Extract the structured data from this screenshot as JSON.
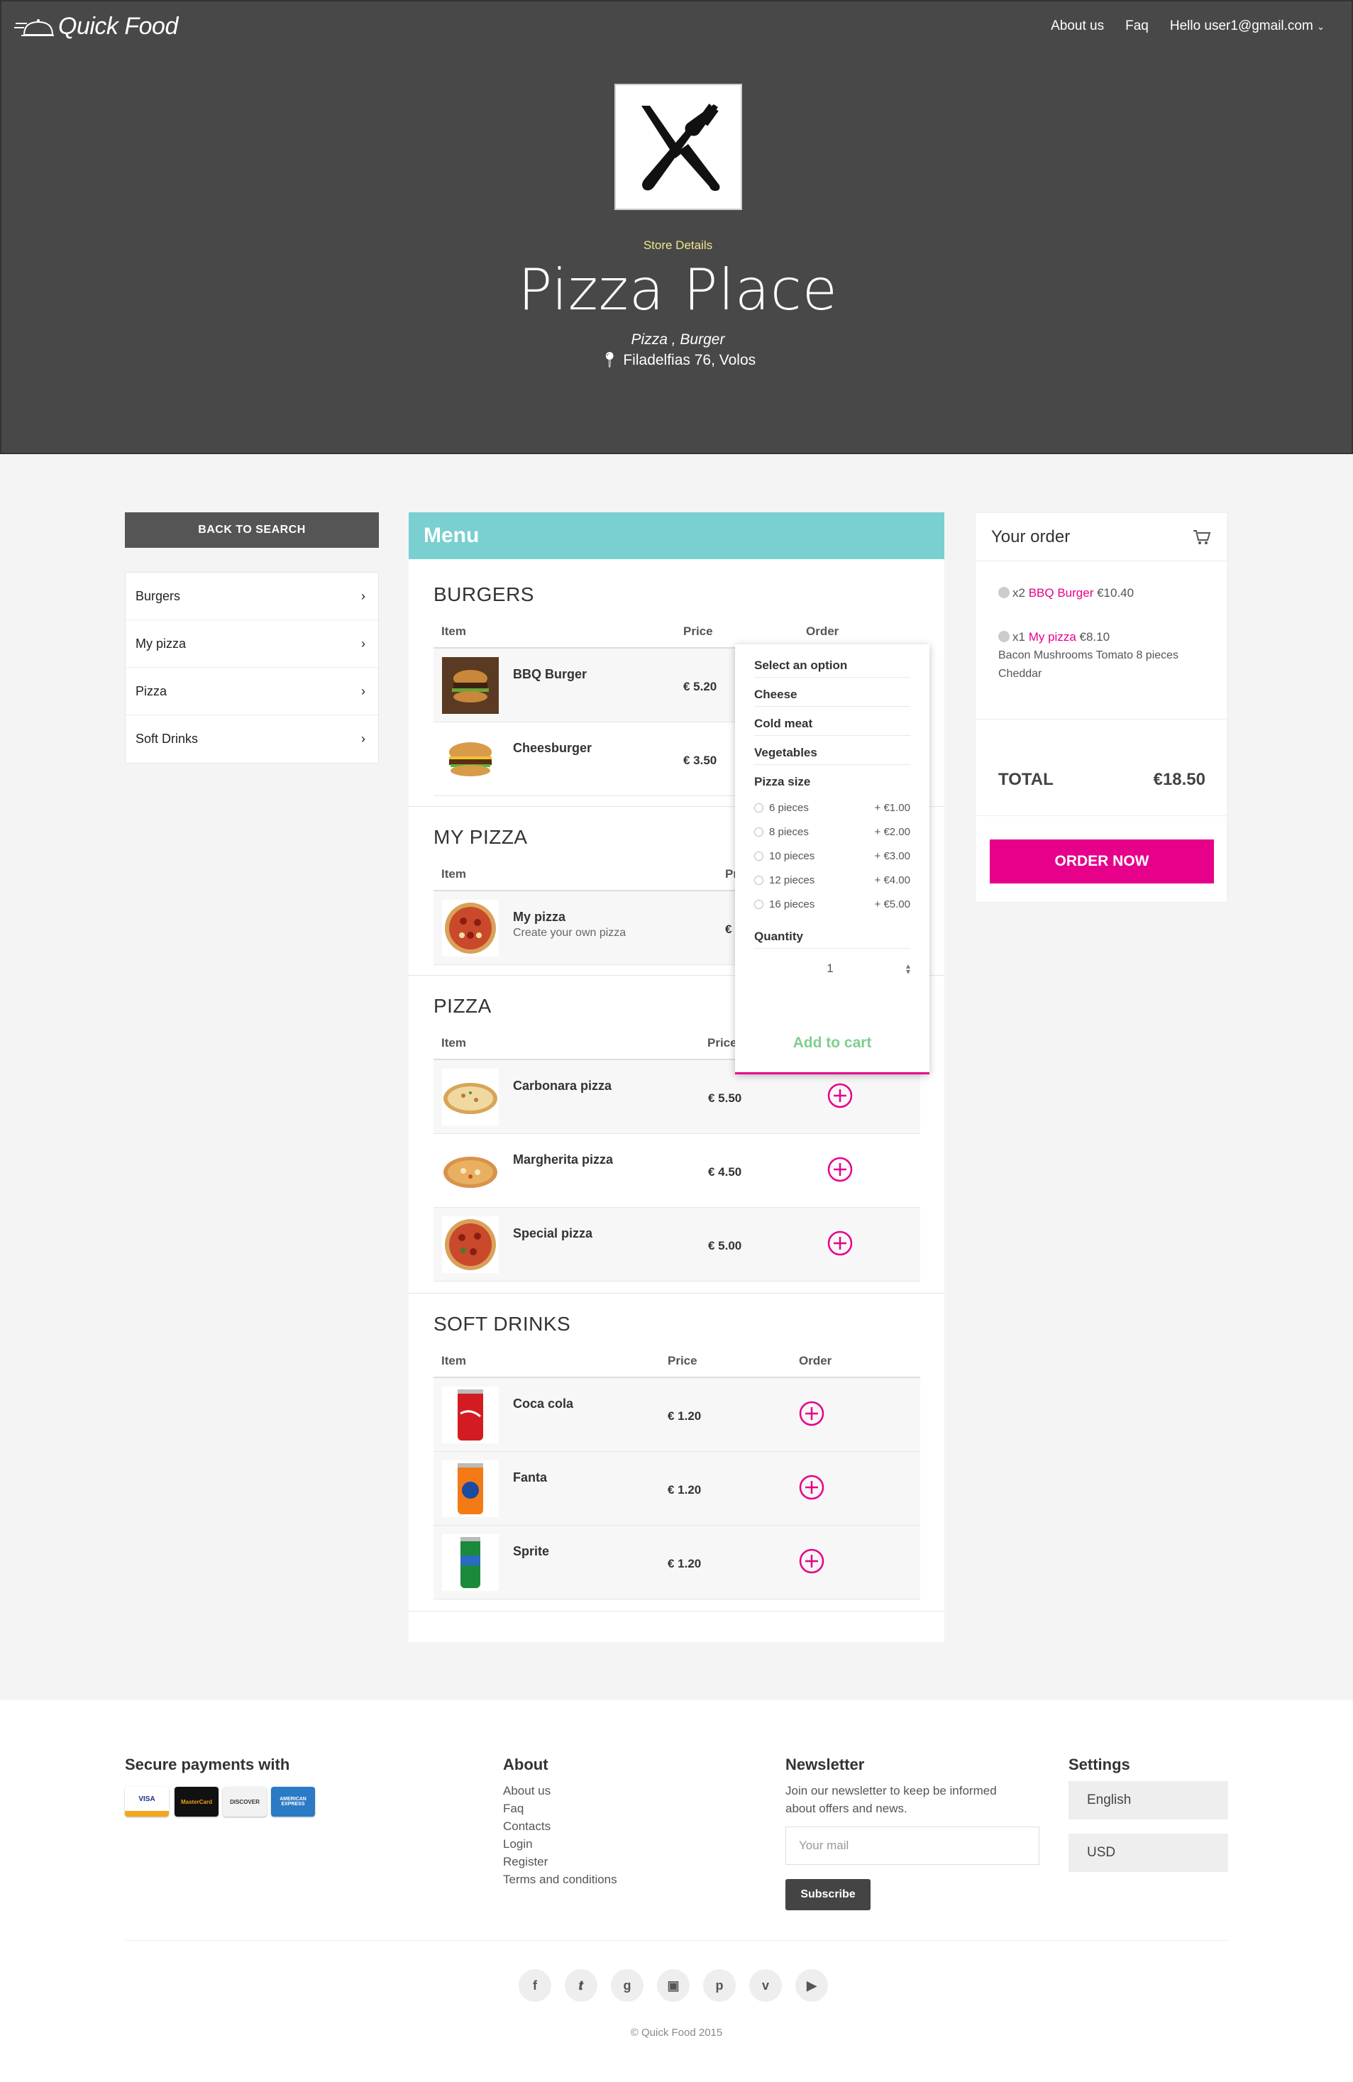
{
  "header": {
    "brand": "Quick Food",
    "nav": [
      "About us",
      "Faq",
      "Hello user1@gmail.com"
    ],
    "store_details_label": "Store Details",
    "store_name": "Pizza Place",
    "store_categories": "Pizza , Burger",
    "store_address": "Filadelfias 76, Volos"
  },
  "sidebar": {
    "back_label": "BACK TO SEARCH",
    "categories": [
      "Burgers",
      "My pizza",
      "Pizza",
      "Soft Drinks"
    ]
  },
  "menu": {
    "title": "Menu",
    "columns": {
      "item": "Item",
      "price": "Price",
      "order": "Order"
    },
    "sections": [
      {
        "title": "BURGERS",
        "items": [
          {
            "name": "BBQ Burger",
            "price": "€ 5.20"
          },
          {
            "name": "Cheesburger",
            "price": "€ 3.50"
          }
        ]
      },
      {
        "title": "MY PIZZA",
        "items": [
          {
            "name": "My pizza",
            "description": "Create your own pizza",
            "price": "€"
          }
        ]
      },
      {
        "title": "PIZZA",
        "items": [
          {
            "name": "Carbonara pizza",
            "price": "€ 5.50"
          },
          {
            "name": "Margherita pizza",
            "price": "€ 4.50"
          },
          {
            "name": "Special pizza",
            "price": "€ 5.00"
          }
        ]
      },
      {
        "title": "SOFT DRINKS",
        "items": [
          {
            "name": "Coca cola",
            "price": "€ 1.20"
          },
          {
            "name": "Fanta",
            "price": "€ 1.20"
          },
          {
            "name": "Sprite",
            "price": "€ 1.20"
          }
        ]
      }
    ]
  },
  "dropdown": {
    "select_label": "Select an option",
    "groups": [
      "Cheese",
      "Cold meat",
      "Vegetables"
    ],
    "size_label": "Pizza size",
    "sizes": [
      {
        "label": "6 pieces",
        "price": "+ €1.00"
      },
      {
        "label": "8 pieces",
        "price": "+ €2.00"
      },
      {
        "label": "10 pieces",
        "price": "+ €3.00"
      },
      {
        "label": "12 pieces",
        "price": "+ €4.00"
      },
      {
        "label": "16 pieces",
        "price": "+ €5.00"
      }
    ],
    "quantity_label": "Quantity",
    "quantity_value": "1",
    "add_to_cart": "Add to cart"
  },
  "order": {
    "title": "Your order",
    "lines": [
      {
        "qty": "x2",
        "name": "BBQ Burger",
        "price": "€10.40",
        "details": ""
      },
      {
        "qty": "x1",
        "name": "My pizza",
        "price": "€8.10",
        "details": "Bacon Mushrooms Tomato 8 pieces Cheddar"
      }
    ],
    "total_label": "TOTAL",
    "total_value": "€18.50",
    "order_button": "ORDER NOW"
  },
  "footer": {
    "payments_title": "Secure payments with",
    "cards": [
      "VISA",
      "MasterCard",
      "DISCOVER",
      "AMERICAN EXPRESS"
    ],
    "about_title": "About",
    "about_links": [
      "About us",
      "Faq",
      "Contacts",
      "Login",
      "Register",
      "Terms and conditions"
    ],
    "newsletter_title": "Newsletter",
    "newsletter_text_1": "Join our newsletter to keep be informed",
    "newsletter_text_2": "about offers and news.",
    "newsletter_placeholder": "Your mail",
    "subscribe_label": "Subscribe",
    "settings_title": "Settings",
    "language": "English",
    "currency": "USD",
    "social_icons": [
      "facebook-icon",
      "twitter-icon",
      "google-plus-icon",
      "instagram-icon",
      "pinterest-icon",
      "vimeo-icon",
      "youtube-icon"
    ],
    "copyright": "© Quick Food 2015"
  },
  "colors": {
    "accent": "#e6008a",
    "menu_header": "#7acfd0",
    "hero_bg": "#484848",
    "add_to_cart": "#7ecf8e"
  }
}
